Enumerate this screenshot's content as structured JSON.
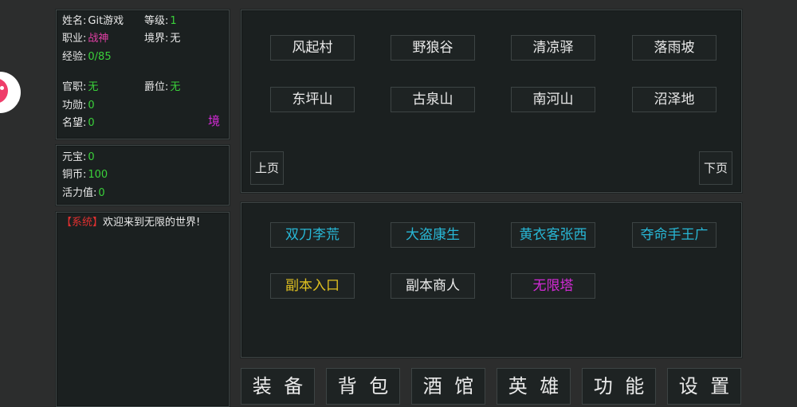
{
  "player": {
    "name_label": "姓名:",
    "name": "Git游戏",
    "level_label": "等级:",
    "level": "1",
    "class_label": "职业:",
    "class": "战神",
    "realm_label": "境界:",
    "realm": "无",
    "exp_label": "经验:",
    "exp": "0/85",
    "office_label": "官职:",
    "office": "无",
    "peerage_label": "爵位:",
    "peerage": "无",
    "merit_label": "功勋:",
    "merit": "0",
    "fame_label": "名望:",
    "fame": "0",
    "realm_button": "境"
  },
  "currency": {
    "ingot_label": "元宝:",
    "ingot": "0",
    "copper_label": "铜币:",
    "copper": "100",
    "energy_label": "活力值:",
    "energy": "0"
  },
  "log": {
    "tag": "【系统】",
    "message": "欢迎来到无限的世界!"
  },
  "locations": [
    "风起村",
    "野狼谷",
    "清凉驿",
    "落雨坡",
    "东坪山",
    "古泉山",
    "南河山",
    "沼泽地"
  ],
  "pager": {
    "prev": "上页",
    "next": "下页"
  },
  "npcs": [
    "双刀李荒",
    "大盗康生",
    "黄衣客张西",
    "夺命手王广",
    "副本入口",
    "副本商人",
    "无限塔"
  ],
  "menu": [
    [
      "装",
      "备"
    ],
    [
      "背",
      "包"
    ],
    [
      "酒",
      "馆"
    ],
    [
      "英",
      "雄"
    ],
    [
      "功",
      "能"
    ],
    [
      "设",
      "置"
    ]
  ],
  "colors": {
    "value_green": "#3ad13a",
    "class_pink": "#e23fa5",
    "npc_cyan": "#28b7d6",
    "npc_yellow": "#e0c020",
    "npc_magenta": "#d52ad8",
    "system_red": "#e03030"
  },
  "icons": {
    "avatar": "pink-mascot-avatar-icon"
  }
}
